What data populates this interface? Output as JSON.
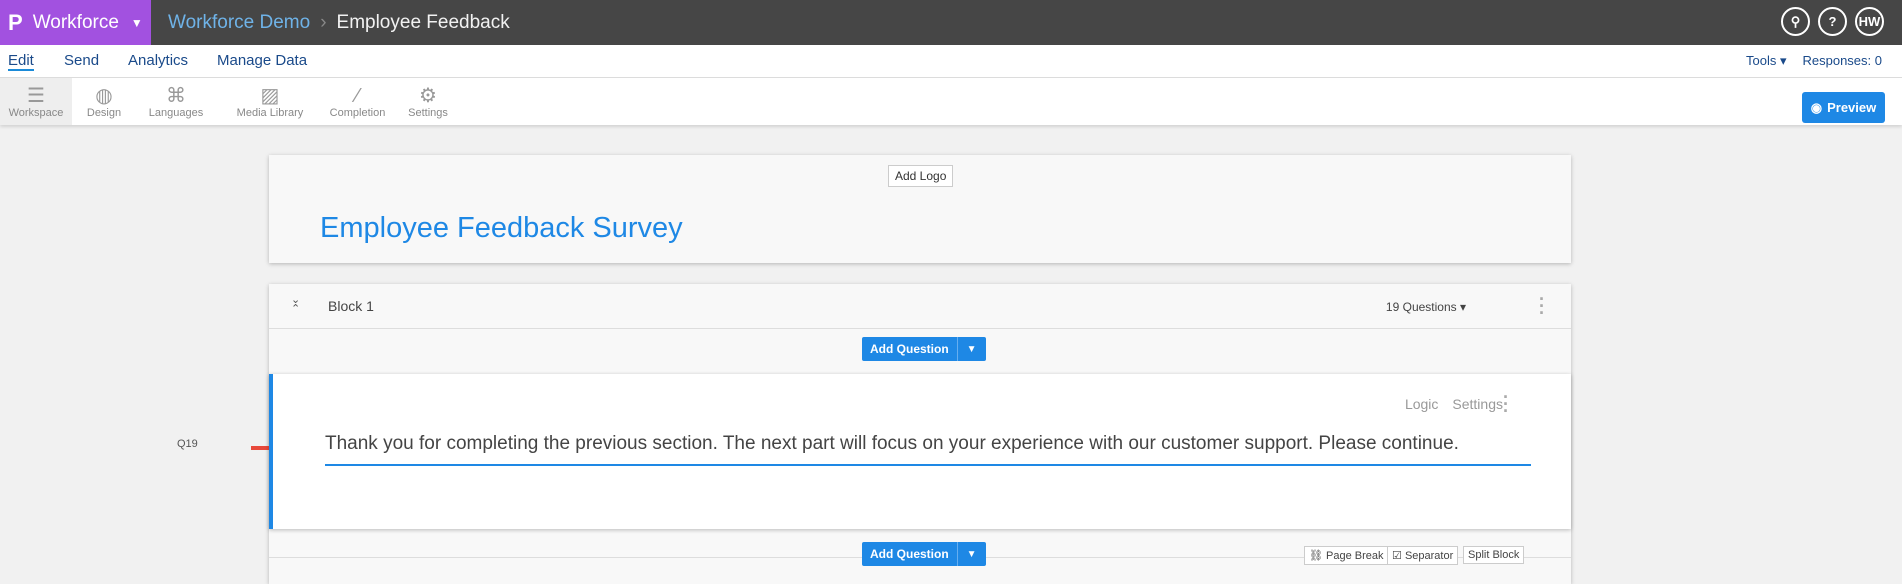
{
  "topbar": {
    "brand": "Workforce",
    "crumb_parent": "Workforce Demo",
    "crumb_current": "Employee Feedback",
    "user_initials": "HW"
  },
  "nav": {
    "items": [
      "Edit",
      "Send",
      "Analytics",
      "Manage Data"
    ],
    "tools": "Tools",
    "responses": "Responses: 0"
  },
  "toolbar": {
    "items": [
      "Workspace",
      "Design",
      "Languages",
      "Media Library",
      "Completion",
      "Settings"
    ],
    "preview": "Preview"
  },
  "survey": {
    "add_logo": "Add Logo",
    "title": "Employee Feedback Survey"
  },
  "block": {
    "name": "Block 1",
    "question_count": "19 Questions",
    "add_question": "Add Question"
  },
  "question": {
    "number": "Q19",
    "logic": "Logic",
    "settings": "Settings",
    "text": "Thank you for completing the previous section. The next part will focus on your experience with our customer support. Please continue."
  },
  "footer": {
    "page_break": "Page Break",
    "separator": "Separator",
    "split_block": "Split Block"
  }
}
